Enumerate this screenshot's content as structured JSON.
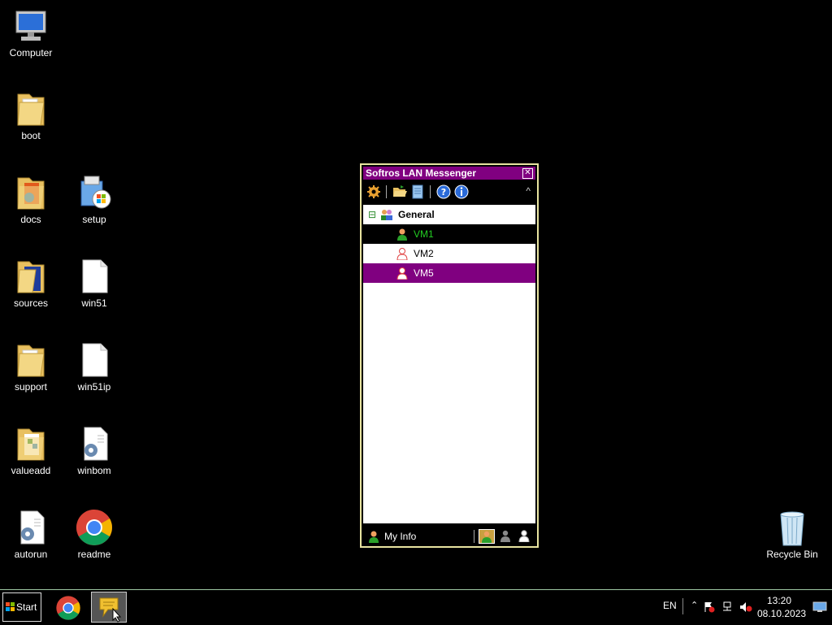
{
  "desktop": {
    "icons": [
      {
        "label": "Computer"
      },
      {
        "label": "boot"
      },
      {
        "label": "docs"
      },
      {
        "label": "setup"
      },
      {
        "label": "sources"
      },
      {
        "label": "win51"
      },
      {
        "label": "support"
      },
      {
        "label": "win51ip"
      },
      {
        "label": "valueadd"
      },
      {
        "label": "winbom"
      },
      {
        "label": "autorun"
      },
      {
        "label": "readme"
      },
      {
        "label": "Recycle Bin"
      }
    ]
  },
  "messenger": {
    "title": "Softros LAN Messenger",
    "close_glyph": "✕",
    "group": {
      "name": "General",
      "expander": "⊟"
    },
    "users": [
      {
        "name": "VM1",
        "text_color": "#22cc22",
        "row_bg": "#000000",
        "icon": "online-user-icon"
      },
      {
        "name": "VM2",
        "text_color": "#000000",
        "row_bg": "#ffffff",
        "icon": "away-user-icon"
      },
      {
        "name": "VM5",
        "text_color": "#ffffff",
        "row_bg": "#800080",
        "icon": "away-user-icon"
      }
    ],
    "myinfo": "My Info",
    "collapse_glyph": "^"
  },
  "taskbar": {
    "start_label": "Start",
    "lang": "EN",
    "time": "13:20",
    "date": "08.10.2023"
  },
  "colors": {
    "accent": "#800080",
    "window_border": "#e8e4a0",
    "online_green": "#22cc22"
  }
}
